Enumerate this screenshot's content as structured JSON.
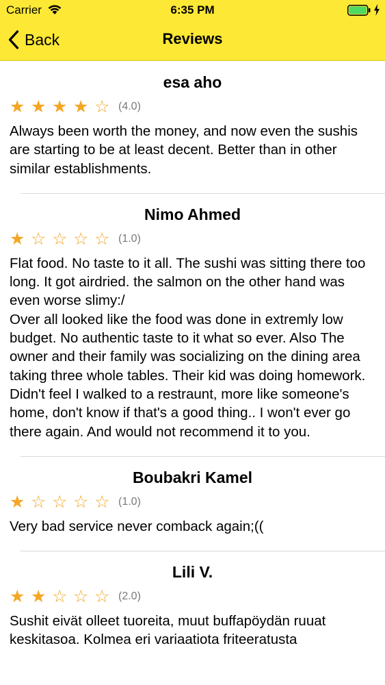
{
  "status_bar": {
    "carrier": "Carrier",
    "time": "6:35 PM",
    "battery_level": 1.0
  },
  "nav": {
    "back_label": "Back",
    "title": "Reviews",
    "background_color": "#fde835"
  },
  "reviews": [
    {
      "name": "esa aho",
      "rating": 4,
      "rating_label": "(4.0)",
      "text": "Always been worth the money, and now even the sushis are starting to be at least decent. Better than in other similar establishments."
    },
    {
      "name": "Nimo Ahmed",
      "rating": 1,
      "rating_label": "(1.0)",
      "text": "Flat food. No taste to it all. The sushi was sitting there too long. It got airdried. the salmon on the other hand was even worse slimy:/\nOver all looked like the food was done in extremly low budget. No authentic taste to it what so ever. Also The owner and their family was socializing on the dining area taking three whole tables. Their kid was doing homework. Didn't feel I walked to a restraunt, more like someone's home, don't know if that's a good thing.. I won't ever go there again. And would not recommend it to you."
    },
    {
      "name": "Boubakri Kamel",
      "rating": 1,
      "rating_label": "(1.0)",
      "text": "Very bad service never comback again;(("
    },
    {
      "name": "Lili V.",
      "rating": 2,
      "rating_label": "(2.0)",
      "text": "Sushit eivät olleet tuoreita, muut buffapöydän ruuat keskitasoa. Kolmea eri variaatiota friteeratusta"
    }
  ],
  "star_color": "#f5a623"
}
